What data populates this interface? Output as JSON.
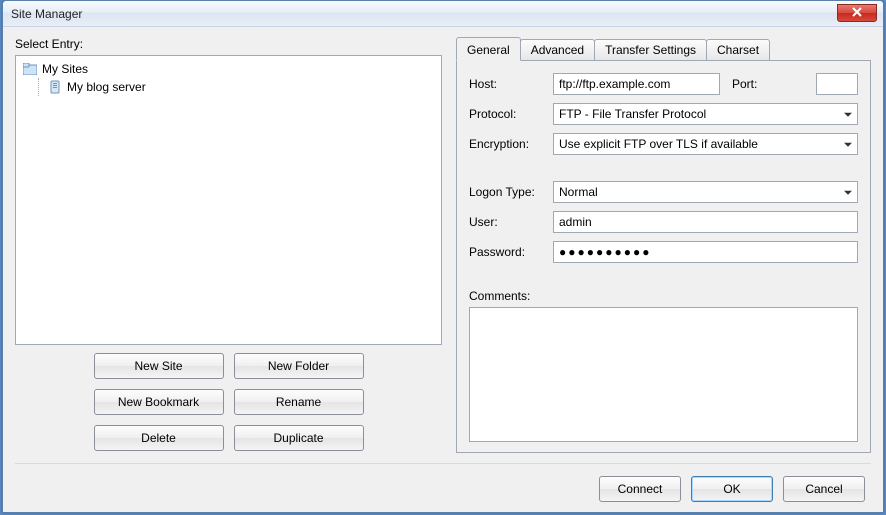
{
  "window": {
    "title": "Site Manager"
  },
  "left": {
    "select_label": "Select Entry:",
    "tree": {
      "root_label": "My Sites",
      "child_label": "My blog server"
    },
    "buttons": {
      "new_site": "New Site",
      "new_folder": "New Folder",
      "new_bookmark": "New Bookmark",
      "rename": "Rename",
      "delete": "Delete",
      "duplicate": "Duplicate"
    }
  },
  "tabs": {
    "general": "General",
    "advanced": "Advanced",
    "transfer": "Transfer Settings",
    "charset": "Charset"
  },
  "form": {
    "host_label": "Host:",
    "host_value": "ftp://ftp.example.com",
    "port_label": "Port:",
    "port_value": "",
    "protocol_label": "Protocol:",
    "protocol_value": "FTP - File Transfer Protocol",
    "encryption_label": "Encryption:",
    "encryption_value": "Use explicit FTP over TLS if available",
    "logon_label": "Logon Type:",
    "logon_value": "Normal",
    "user_label": "User:",
    "user_value": "admin",
    "password_label": "Password:",
    "password_value": "●●●●●●●●●●",
    "comments_label": "Comments:",
    "comments_value": ""
  },
  "bottom": {
    "connect": "Connect",
    "ok": "OK",
    "cancel": "Cancel"
  }
}
